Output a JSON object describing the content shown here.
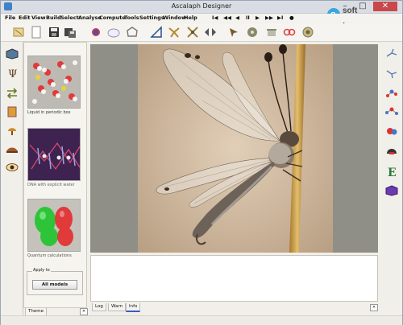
{
  "window": {
    "title": "Ascalaph Designer"
  },
  "menu": [
    "File",
    "Edit",
    "View",
    "Build",
    "Select",
    "Analyse",
    "Compute",
    "Tools",
    "Settings",
    "Window",
    "Help"
  ],
  "playback": [
    "I◀",
    "◀◀",
    "◀",
    "II",
    "▶",
    "▶▶",
    "▶I",
    "●"
  ],
  "toolbar_icons": [
    "molecule-icon",
    "new-document-icon",
    "save-icon",
    "save-as-icon",
    "atom-icon",
    "cloud-surface-icon",
    "ring-icon",
    "triangle-geometry-icon",
    "torsion-icon",
    "bond-rotate-icon",
    "flip-arrows-icon",
    "mouse-tool-icon",
    "gear-cluster-icon",
    "pot-icon",
    "link-icon",
    "circle-structure-icon"
  ],
  "left_tools": [
    "cube-icon",
    "psi-icon",
    "arrows-exchange-icon",
    "book-icon",
    "lamp-icon",
    "hat-icon",
    "eye-icon"
  ],
  "theme_panel": {
    "thumbnails": [
      {
        "label": "Liquid in periodic box"
      },
      {
        "label": "DNA with explicit water"
      },
      {
        "label": "Quantum calculations"
      }
    ],
    "apply_group": {
      "title": "Apply to",
      "button": "All models"
    },
    "tab": "Theme"
  },
  "log_tabs": [
    "Log",
    "Warn",
    "Info"
  ],
  "right_tools": [
    "branch-icon-1",
    "branch-icon-2",
    "molecule-red-icon",
    "molecule-blue-icon",
    "helmet-icon",
    "red-blue-icon",
    "energy-e-icon",
    "purple-cube-icon"
  ],
  "watermark": {
    "line1": "soft",
    "line2": "planet",
    "suffix": ".com"
  },
  "colors": {
    "accent": "#3a5bbf",
    "viewport_bg": "#8f8f88"
  }
}
